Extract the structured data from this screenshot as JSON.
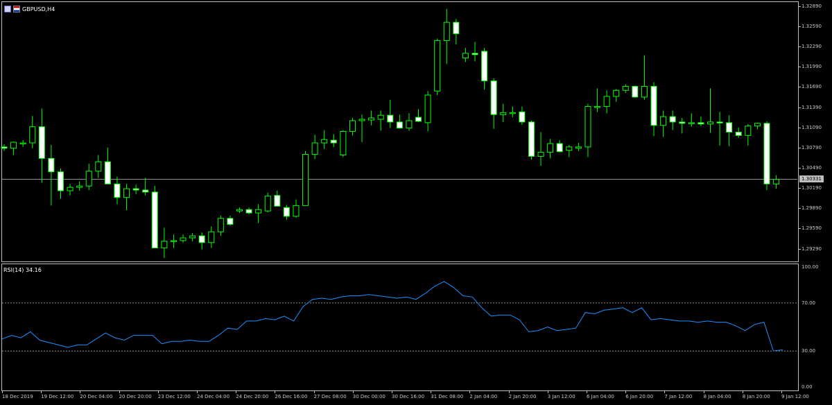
{
  "window": {
    "symbol_label": "GBPUSD,H4",
    "background": "#000000",
    "bull_color": "#00ff00",
    "bear_candle_fill": "#ffffff",
    "grid_color": "#c0c0c0"
  },
  "price_scale": {
    "labels": [
      "1.32890",
      "1.32590",
      "1.32290",
      "1.31990",
      "1.31690",
      "1.31390",
      "1.31090",
      "1.30790",
      "1.30490",
      "1.30190",
      "1.29890",
      "1.29590",
      "1.29290"
    ],
    "current_price_label": "1.30331"
  },
  "rsi": {
    "title": "RSI(14) 34.16",
    "scale_labels": [
      "100.00",
      "70.00",
      "30.00",
      "0.00"
    ],
    "levels": [
      70,
      30
    ],
    "line_color": "#1e90ff"
  },
  "time_axis": {
    "labels": [
      "18 Dec 2019",
      "19 Dec 12:00",
      "20 Dec 04:00",
      "20 Dec 20:00",
      "23 Dec 12:00",
      "24 Dec 04:00",
      "24 Dec 20:00",
      "26 Dec 16:00",
      "27 Dec 08:00",
      "30 Dec 00:00",
      "30 Dec 16:00",
      "31 Dec 08:00",
      "2 Jan 04:00",
      "2 Jan 20:00",
      "3 Jan 12:00",
      "6 Jan 04:00",
      "6 Jan 20:00",
      "7 Jan 12:00",
      "8 Jan 04:00",
      "8 Jan 20:00",
      "9 Jan 12:00"
    ]
  },
  "chart_data": {
    "type": "candlestick",
    "timeframe": "H4",
    "ylim": [
      1.291,
      1.3295
    ],
    "rsi_ylim": [
      0,
      100
    ],
    "candles": [
      {
        "o": 1.308,
        "h": 1.3084,
        "l": 1.3074,
        "c": 1.3078
      },
      {
        "o": 1.3078,
        "h": 1.3088,
        "l": 1.3068,
        "c": 1.3087
      },
      {
        "o": 1.3085,
        "h": 1.309,
        "l": 1.308,
        "c": 1.3086
      },
      {
        "o": 1.3086,
        "h": 1.3126,
        "l": 1.3078,
        "c": 1.311
      },
      {
        "o": 1.311,
        "h": 1.3137,
        "l": 1.3027,
        "c": 1.3063
      },
      {
        "o": 1.3063,
        "h": 1.3083,
        "l": 1.2993,
        "c": 1.3043
      },
      {
        "o": 1.3043,
        "h": 1.3048,
        "l": 1.3003,
        "c": 1.3015
      },
      {
        "o": 1.3015,
        "h": 1.3025,
        "l": 1.3008,
        "c": 1.302
      },
      {
        "o": 1.302,
        "h": 1.3029,
        "l": 1.3015,
        "c": 1.3022
      },
      {
        "o": 1.3022,
        "h": 1.3055,
        "l": 1.3016,
        "c": 1.3044
      },
      {
        "o": 1.3044,
        "h": 1.3068,
        "l": 1.3034,
        "c": 1.3058
      },
      {
        "o": 1.3058,
        "h": 1.3079,
        "l": 1.3025,
        "c": 1.3025
      },
      {
        "o": 1.3025,
        "h": 1.3036,
        "l": 1.2995,
        "c": 1.3005
      },
      {
        "o": 1.3005,
        "h": 1.3025,
        "l": 1.2986,
        "c": 1.3018
      },
      {
        "o": 1.3018,
        "h": 1.3024,
        "l": 1.301,
        "c": 1.3016
      },
      {
        "o": 1.3016,
        "h": 1.3034,
        "l": 1.3008,
        "c": 1.3013
      },
      {
        "o": 1.3013,
        "h": 1.3022,
        "l": 1.293,
        "c": 1.293
      },
      {
        "o": 1.293,
        "h": 1.296,
        "l": 1.2915,
        "c": 1.294
      },
      {
        "o": 1.294,
        "h": 1.295,
        "l": 1.293,
        "c": 1.2941
      },
      {
        "o": 1.2941,
        "h": 1.295,
        "l": 1.2938,
        "c": 1.2945
      },
      {
        "o": 1.2945,
        "h": 1.2952,
        "l": 1.294,
        "c": 1.2948
      },
      {
        "o": 1.2948,
        "h": 1.2953,
        "l": 1.2928,
        "c": 1.2938
      },
      {
        "o": 1.2938,
        "h": 1.2962,
        "l": 1.293,
        "c": 1.2954
      },
      {
        "o": 1.2954,
        "h": 1.2978,
        "l": 1.2948,
        "c": 1.2974
      },
      {
        "o": 1.2974,
        "h": 1.2978,
        "l": 1.2963,
        "c": 1.2965
      },
      {
        "o": 1.2985,
        "h": 1.299,
        "l": 1.2982,
        "c": 1.2987
      },
      {
        "o": 1.2987,
        "h": 1.299,
        "l": 1.298,
        "c": 1.2982
      },
      {
        "o": 1.2982,
        "h": 1.2995,
        "l": 1.2967,
        "c": 1.2987
      },
      {
        "o": 1.2985,
        "h": 1.3012,
        "l": 1.2983,
        "c": 1.3007
      },
      {
        "o": 1.3008,
        "h": 1.3015,
        "l": 1.2992,
        "c": 1.2992
      },
      {
        "o": 1.299,
        "h": 1.2994,
        "l": 1.2972,
        "c": 1.2977
      },
      {
        "o": 1.2977,
        "h": 1.3002,
        "l": 1.2975,
        "c": 1.2993
      },
      {
        "o": 1.2993,
        "h": 1.3074,
        "l": 1.2993,
        "c": 1.3069
      },
      {
        "o": 1.3069,
        "h": 1.3098,
        "l": 1.3062,
        "c": 1.3086
      },
      {
        "o": 1.3086,
        "h": 1.3105,
        "l": 1.3077,
        "c": 1.3091
      },
      {
        "o": 1.309,
        "h": 1.3099,
        "l": 1.308,
        "c": 1.3086
      },
      {
        "o": 1.3068,
        "h": 1.3105,
        "l": 1.3065,
        "c": 1.3103
      },
      {
        "o": 1.3103,
        "h": 1.3123,
        "l": 1.3097,
        "c": 1.3119
      },
      {
        "o": 1.3119,
        "h": 1.3128,
        "l": 1.3087,
        "c": 1.3121
      },
      {
        "o": 1.312,
        "h": 1.3134,
        "l": 1.3112,
        "c": 1.3123
      },
      {
        "o": 1.3121,
        "h": 1.3134,
        "l": 1.3104,
        "c": 1.3127
      },
      {
        "o": 1.3127,
        "h": 1.315,
        "l": 1.3108,
        "c": 1.3117
      },
      {
        "o": 1.3117,
        "h": 1.3128,
        "l": 1.3107,
        "c": 1.3108
      },
      {
        "o": 1.3108,
        "h": 1.313,
        "l": 1.3104,
        "c": 1.3119
      },
      {
        "o": 1.3124,
        "h": 1.3136,
        "l": 1.3117,
        "c": 1.3118
      },
      {
        "o": 1.3116,
        "h": 1.3163,
        "l": 1.3103,
        "c": 1.3157
      },
      {
        "o": 1.3163,
        "h": 1.3241,
        "l": 1.3157,
        "c": 1.3238
      },
      {
        "o": 1.3238,
        "h": 1.3285,
        "l": 1.3203,
        "c": 1.3265
      },
      {
        "o": 1.3265,
        "h": 1.327,
        "l": 1.3232,
        "c": 1.3248
      },
      {
        "o": 1.3212,
        "h": 1.3227,
        "l": 1.3206,
        "c": 1.3219
      },
      {
        "o": 1.3219,
        "h": 1.3236,
        "l": 1.3207,
        "c": 1.3217
      },
      {
        "o": 1.3222,
        "h": 1.3227,
        "l": 1.3165,
        "c": 1.3178
      },
      {
        "o": 1.3178,
        "h": 1.3182,
        "l": 1.3107,
        "c": 1.3128
      },
      {
        "o": 1.3128,
        "h": 1.3144,
        "l": 1.3117,
        "c": 1.3131
      },
      {
        "o": 1.3131,
        "h": 1.314,
        "l": 1.3124,
        "c": 1.3131
      },
      {
        "o": 1.3132,
        "h": 1.314,
        "l": 1.3113,
        "c": 1.3117
      },
      {
        "o": 1.3117,
        "h": 1.3119,
        "l": 1.3061,
        "c": 1.3066
      },
      {
        "o": 1.3066,
        "h": 1.3102,
        "l": 1.3052,
        "c": 1.3072
      },
      {
        "o": 1.3072,
        "h": 1.3092,
        "l": 1.3063,
        "c": 1.3085
      },
      {
        "o": 1.3085,
        "h": 1.309,
        "l": 1.3072,
        "c": 1.3073
      },
      {
        "o": 1.3075,
        "h": 1.3083,
        "l": 1.3065,
        "c": 1.308
      },
      {
        "o": 1.3078,
        "h": 1.3086,
        "l": 1.3074,
        "c": 1.308
      },
      {
        "o": 1.308,
        "h": 1.3144,
        "l": 1.3065,
        "c": 1.314
      },
      {
        "o": 1.314,
        "h": 1.3167,
        "l": 1.3132,
        "c": 1.314
      },
      {
        "o": 1.314,
        "h": 1.3164,
        "l": 1.313,
        "c": 1.3155
      },
      {
        "o": 1.3155,
        "h": 1.3166,
        "l": 1.3147,
        "c": 1.3164
      },
      {
        "o": 1.3164,
        "h": 1.3173,
        "l": 1.316,
        "c": 1.317
      },
      {
        "o": 1.317,
        "h": 1.3171,
        "l": 1.3153,
        "c": 1.3154
      },
      {
        "o": 1.3154,
        "h": 1.3216,
        "l": 1.315,
        "c": 1.317
      },
      {
        "o": 1.317,
        "h": 1.3176,
        "l": 1.3096,
        "c": 1.3112
      },
      {
        "o": 1.3112,
        "h": 1.3134,
        "l": 1.3095,
        "c": 1.3125
      },
      {
        "o": 1.3125,
        "h": 1.3134,
        "l": 1.3105,
        "c": 1.3117
      },
      {
        "o": 1.3117,
        "h": 1.3123,
        "l": 1.31,
        "c": 1.3115
      },
      {
        "o": 1.3115,
        "h": 1.313,
        "l": 1.311,
        "c": 1.3116
      },
      {
        "o": 1.3116,
        "h": 1.3125,
        "l": 1.3111,
        "c": 1.3114
      },
      {
        "o": 1.3114,
        "h": 1.3167,
        "l": 1.3101,
        "c": 1.3117
      },
      {
        "o": 1.3117,
        "h": 1.3132,
        "l": 1.3082,
        "c": 1.3116
      },
      {
        "o": 1.3116,
        "h": 1.3127,
        "l": 1.3081,
        "c": 1.3102
      },
      {
        "o": 1.3102,
        "h": 1.3109,
        "l": 1.3094,
        "c": 1.3097
      },
      {
        "o": 1.3097,
        "h": 1.3114,
        "l": 1.3082,
        "c": 1.3111
      },
      {
        "o": 1.3111,
        "h": 1.3116,
        "l": 1.3106,
        "c": 1.3115
      },
      {
        "o": 1.3115,
        "h": 1.3118,
        "l": 1.3016,
        "c": 1.3025
      },
      {
        "o": 1.3025,
        "h": 1.3038,
        "l": 1.3018,
        "c": 1.3032
      }
    ],
    "rsi_values": [
      40,
      43,
      41,
      46,
      39,
      37,
      35,
      33,
      35,
      35,
      40,
      45,
      41,
      39,
      43,
      43,
      43,
      36,
      38,
      38,
      39,
      38,
      38,
      43,
      49,
      48,
      55,
      55,
      57,
      56,
      59,
      55,
      67,
      73,
      74,
      73,
      75,
      76,
      76,
      77,
      76,
      75,
      74,
      75,
      73,
      78,
      84,
      88,
      83,
      76,
      75,
      66,
      59,
      60,
      60,
      56,
      46,
      47,
      50,
      47,
      48,
      49,
      62,
      61,
      64,
      65,
      66,
      62,
      66,
      56,
      57,
      56,
      55,
      55,
      54,
      55,
      54,
      54,
      51,
      47,
      52,
      54,
      30,
      31
    ]
  }
}
